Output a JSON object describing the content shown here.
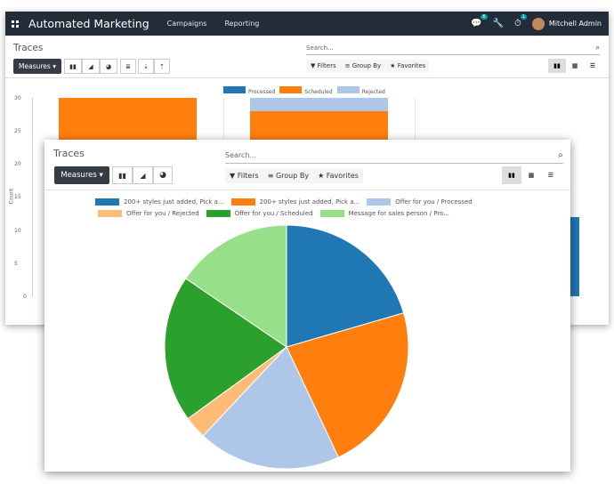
{
  "back": {
    "app_name": "Automated Marketing",
    "menu": [
      "Campaigns",
      "Reporting"
    ],
    "badges": [
      "6",
      "1"
    ],
    "user": "Mitchell Admin",
    "breadcrumb": "Traces",
    "measures_label": "Measures",
    "search_placeholder": "Search...",
    "filters_label": "Filters",
    "groupby_label": "Group By",
    "favorites_label": "Favorites",
    "legend": [
      "Processed",
      "Scheduled",
      "Rejected"
    ],
    "y_ticks": [
      "30",
      "25",
      "20",
      "15",
      "10",
      "5",
      "0"
    ],
    "y_label": "Count"
  },
  "front": {
    "breadcrumb": "Traces",
    "measures_label": "Measures",
    "search_placeholder": "Search...",
    "filters_label": "Filters",
    "groupby_label": "Group By",
    "favorites_label": "Favorites"
  },
  "colors": {
    "topbar": "#232c39",
    "blue": "#1f77b4",
    "orange": "#ff7f0e",
    "light_blue": "#aec7e8",
    "light_orange": "#ffbb78",
    "green": "#2ca02c",
    "light_green": "#98df8a"
  },
  "chart_data": [
    {
      "type": "bar",
      "categories": [
        "",
        "",
        ""
      ],
      "series": [
        {
          "name": "Processed",
          "values": [
            0,
            0,
            12
          ]
        },
        {
          "name": "Scheduled",
          "values": [
            30,
            28,
            0
          ]
        },
        {
          "name": "Rejected",
          "values": [
            0,
            2,
            0
          ]
        }
      ],
      "xlabel": "",
      "ylabel": "Count",
      "ylim": [
        0,
        30
      ],
      "legend": "top-center"
    },
    {
      "type": "pie",
      "labels": [
        "200+ styles just added, Pick a...",
        "200+ styles just added, Pick a...",
        "Offer for you / Processed",
        "Offer for you / Rejected",
        "Offer for you / Scheduled",
        "Message for sales person / Pro..."
      ],
      "values": [
        20.5,
        22.5,
        19,
        3,
        19.5,
        15.5
      ],
      "colors": [
        "#1f77b4",
        "#ff7f0e",
        "#aec7e8",
        "#ffbb78",
        "#2ca02c",
        "#98df8a"
      ],
      "legend": "top"
    }
  ]
}
